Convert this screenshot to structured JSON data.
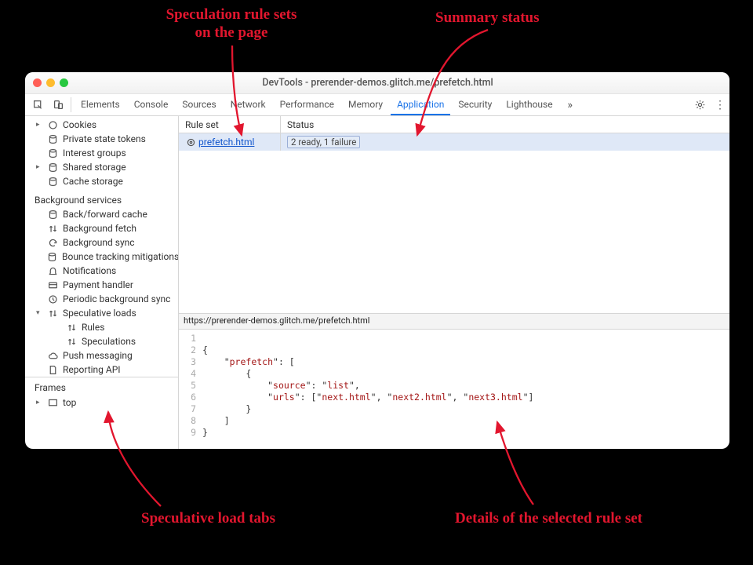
{
  "annotations": {
    "a1": "Speculation rule sets\non the page",
    "a2": "Summary status",
    "a3": "Speculative load tabs",
    "a4": "Details of the selected rule set"
  },
  "window": {
    "title": "DevTools - prerender-demos.glitch.me/prefetch.html"
  },
  "tabs": {
    "t0": "Elements",
    "t1": "Console",
    "t2": "Sources",
    "t3": "Network",
    "t4": "Performance",
    "t5": "Memory",
    "t6": "Application",
    "t7": "Security",
    "t8": "Lighthouse"
  },
  "sidebar": {
    "items": {
      "cookies": "Cookies",
      "pst": "Private state tokens",
      "ig": "Interest groups",
      "ss": "Shared storage",
      "cs": "Cache storage"
    },
    "bg_label": "Background services",
    "bg": {
      "bfc": "Back/forward cache",
      "bf": "Background fetch",
      "bs": "Background sync",
      "btm": "Bounce tracking mitigations",
      "not": "Notifications",
      "ph": "Payment handler",
      "pbs": "Periodic background sync",
      "sl": "Speculative loads",
      "rules": "Rules",
      "specs": "Speculations",
      "pm": "Push messaging",
      "rapi": "Reporting API"
    },
    "frames_label": "Frames",
    "frames_top": "top"
  },
  "table": {
    "col_ruleset": "Rule set",
    "col_status": "Status",
    "row0_ruleset": " prefetch.html",
    "row0_status": "2 ready, 1 failure",
    "url": "https://prerender-demos.glitch.me/prefetch.html"
  },
  "code": {
    "l1": "",
    "l2": "{",
    "l3_a": "    \"",
    "l3_b": "prefetch",
    "l3_c": "\": [",
    "l4": "        {",
    "l5_a": "            \"",
    "l5_b": "source",
    "l5_c": "\": \"",
    "l5_d": "list",
    "l5_e": "\",",
    "l6_a": "            \"",
    "l6_b": "urls",
    "l6_c": "\": [\"",
    "l6_d": "next.html",
    "l6_e": "\", \"",
    "l6_f": "next2.html",
    "l6_g": "\", \"",
    "l6_h": "next3.html",
    "l6_i": "\"]",
    "l7": "        }",
    "l8": "    ]",
    "l9": "}"
  }
}
